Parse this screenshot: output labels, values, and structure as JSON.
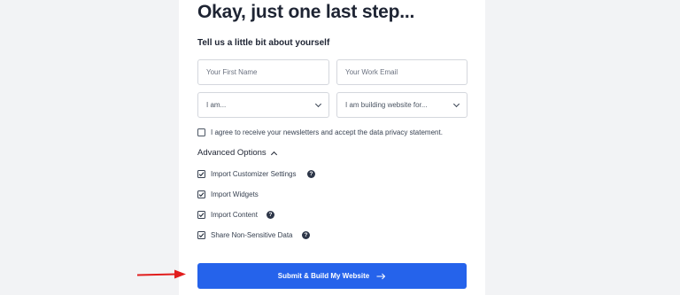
{
  "title": "Okay, just one last step...",
  "subtitle": "Tell us a little bit about yourself",
  "fields": {
    "first_name_placeholder": "Your First Name",
    "work_email_placeholder": "Your Work Email",
    "role_select": "I am...",
    "purpose_select": "I am building website for..."
  },
  "newsletter_label": "I agree to receive your newsletters and accept the data privacy statement.",
  "advanced": {
    "label": "Advanced Options",
    "options": [
      {
        "label": "Import Customizer Settings",
        "checked": true,
        "help": true
      },
      {
        "label": "Import Widgets",
        "checked": true,
        "help": false
      },
      {
        "label": "Import Content",
        "checked": true,
        "help": true
      },
      {
        "label": "Share Non-Sensitive Data",
        "checked": true,
        "help": true
      }
    ]
  },
  "submit_label": "Submit & Build My Website",
  "colors": {
    "accent": "#2563eb",
    "arrow": "#e11d1d",
    "background": "#f2f3f5"
  },
  "icons": {
    "help": "question-circle-icon",
    "submit_arrow": "arrow-right-icon",
    "pointer": "red-arrow-icon"
  }
}
